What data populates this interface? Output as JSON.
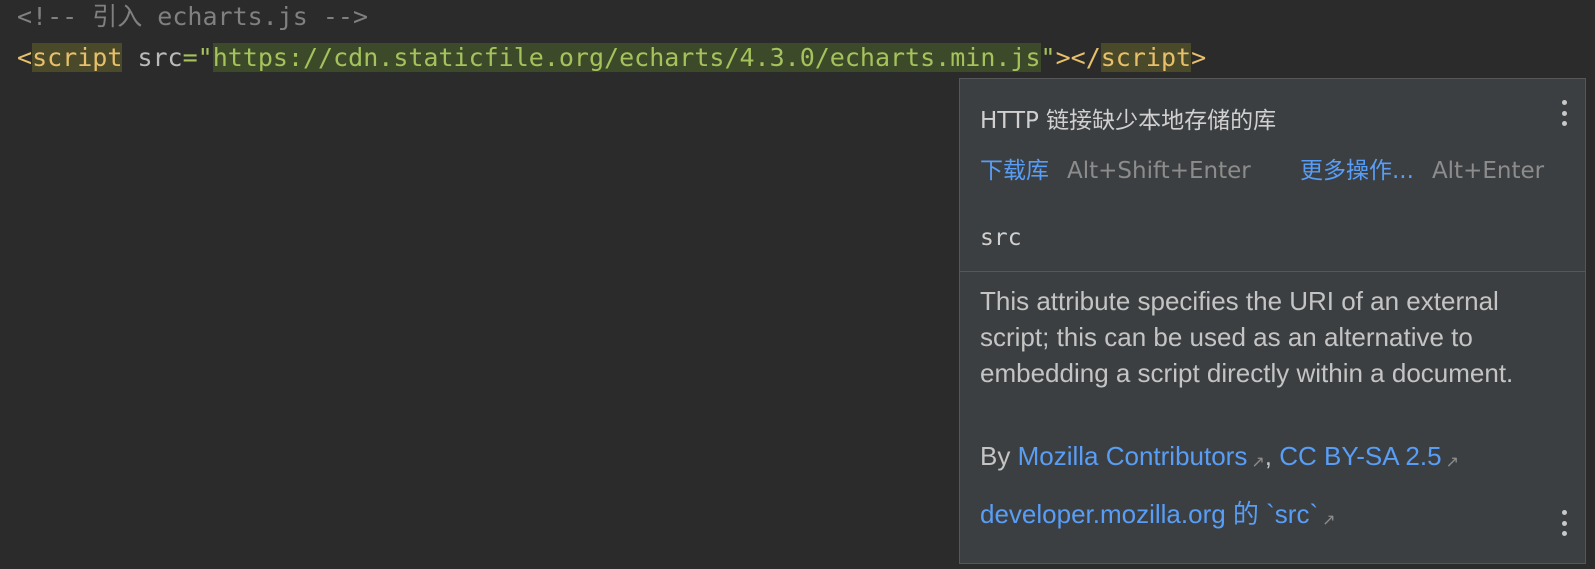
{
  "code": {
    "line1": "<!-- 引入 echarts.js -->",
    "line2": {
      "open_bracket": "<",
      "tag": "script",
      "attr": "src",
      "eq": "=\"",
      "value": "https://cdn.staticfile.org/echarts/4.3.0/echarts.min.js",
      "close_quote": "\"",
      "mid": "></",
      "close_tag": "script",
      "end_bracket": ">"
    }
  },
  "popup": {
    "title": "HTTP 链接缺少本地存储的库",
    "download_label": "下载库",
    "download_shortcut": "Alt+Shift+Enter",
    "more_label": "更多操作...",
    "more_shortcut": "Alt+Enter",
    "attr_name": "src",
    "description": "This attribute specifies the URI of an external script; this can be used as an alternative to embedding a script directly within a document.",
    "by_label": "By",
    "contributors_link": "Mozilla Contributors",
    "comma": ",",
    "license_link": "CC BY-SA 2.5",
    "dev_link": "developer.mozilla.org 的 `src`",
    "ext_icon": "external-link-icon"
  },
  "colors": {
    "editor_bg": "#2b2b2b",
    "popup_bg": "#3c3f41",
    "link": "#589df6",
    "tag": "#e8bf6a",
    "string": "#a5c25c",
    "comment": "#808080"
  }
}
